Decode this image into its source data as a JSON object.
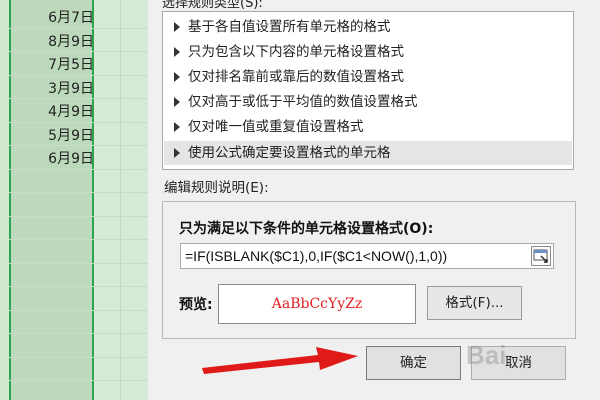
{
  "sheet": {
    "dates": [
      "6月7日",
      "8月9日",
      "7月5日",
      "3月9日",
      "4月9日",
      "5月9日",
      "6月9日"
    ]
  },
  "dialog": {
    "list_label": "选择规则类型(S):",
    "rule_types": [
      "基于各自值设置所有单元格的格式",
      "只为包含以下内容的单元格设置格式",
      "仅对排名靠前或靠后的数值设置格式",
      "仅对高于或低于平均值的数值设置格式",
      "仅对唯一值或重复值设置格式",
      "使用公式确定要设置格式的单元格"
    ],
    "selected_index": 5,
    "description_label": "编辑规则说明(E):",
    "condition_heading": "只为满足以下条件的单元格设置格式(O):",
    "formula": "=IF(ISBLANK($C1),0,IF($C1<NOW(),1,0))",
    "preview_label": "预览:",
    "preview_text": "AaBbCcYyZz",
    "preview_color": "#e02020",
    "format_button": "格式(F)...",
    "ok_button": "确定",
    "cancel_button": "取消"
  },
  "annotation": {
    "arrow_color": "#e01919",
    "watermark": "Bai"
  }
}
